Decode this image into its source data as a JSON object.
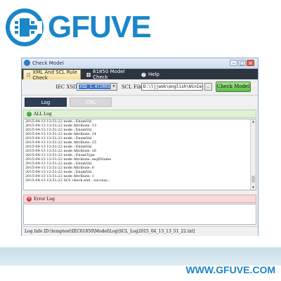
{
  "brand": {
    "name": "GFUVE",
    "website": "WWW.GFUVE.COM",
    "color": "#1b86c8"
  },
  "window": {
    "title": "Check Model",
    "controls": [
      "minimize",
      "maximize",
      "close"
    ]
  },
  "tabs": [
    {
      "label": "XML And SCL Rule Check",
      "icon": "file-icon",
      "active": true
    },
    {
      "label": "61850 Model Check",
      "icon": "grid-icon",
      "active": false
    },
    {
      "label": "Help",
      "icon": "help-icon",
      "active": false
    }
  ],
  "settings": {
    "iec_xsd_label": "IEC XSD",
    "iec_xsd_value": "XSD_1.4(2003)",
    "scl_file_label": "SCL File",
    "scl_file_value": "D:\\ljjwok\\english\\WinIec_EN\\Rele",
    "browse_label": "..",
    "check_model_label": "Check Model"
  },
  "view_toggle": {
    "log_label": "Log",
    "xml_label": "XML"
  },
  "all_log": {
    "label": "ALL Log",
    "lines": [
      "2015-04-13 13:51:22 node : EnumVal",
      "2015-04-13 13:51:22 node Attribute: 13",
      "2015-04-13 13:51:22 node : EnumVal",
      "2015-04-13 13:51:22 node Attribute: 14",
      "2015-04-13 13:51:22 node : EnumVal",
      "2015-04-13 13:51:22 node Attribute: 15",
      "2015-04-13 13:51:22 node : EnumVal",
      "2015-04-13 13:51:22 node Attribute: 16",
      "2015-04-13 13:51:22 node : EnumType",
      "2015-04-13 13:51:22 node Attribute: seqEName",
      "2015-04-13 13:51:22 node : EnumVal",
      "2015-04-13 13:51:22 node Attribute: 0",
      "2015-04-13 13:51:22 node : EnumVal",
      "2015-04-13 13:51:22 node Attribute: 1",
      "2015-04-13 13:51:22 SCL check end , success..."
    ]
  },
  "error_log": {
    "label": "Error Log"
  },
  "status_bar": {
    "text": "Log Info [D:\\temptest\\IEC61850\\Model\\Log\\SCL_Log2015_04_13_13_51_22.txt]"
  }
}
